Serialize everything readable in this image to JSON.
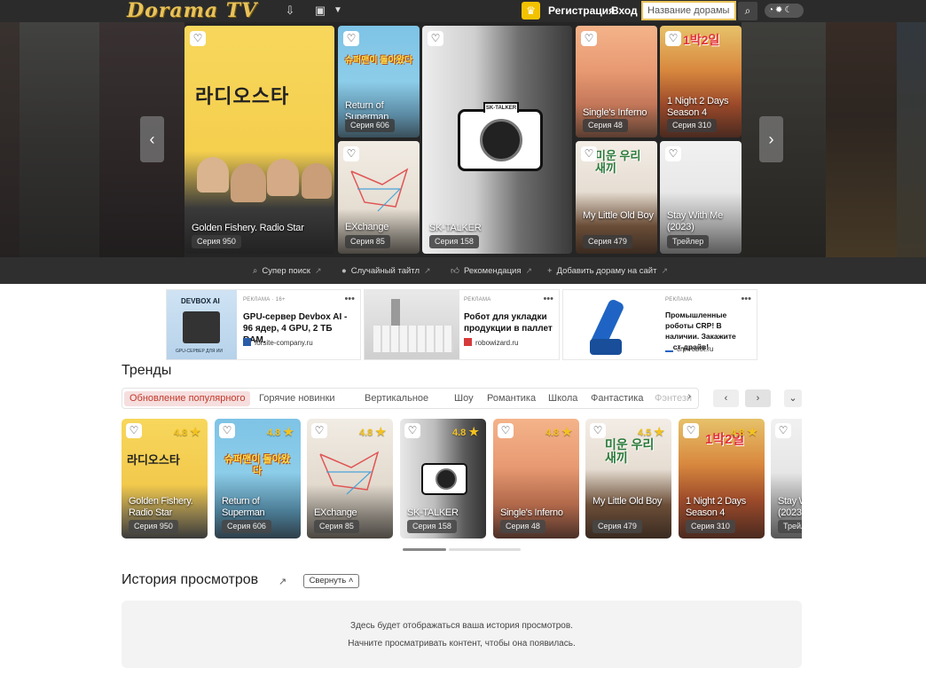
{
  "header": {
    "logo": "Dorama TV",
    "register_label": "Регистрация",
    "login_label": "Вход",
    "search_placeholder": "Название дорамы",
    "icons": [
      "download-icon",
      "tv-icon",
      "chevron-down-icon",
      "crown-icon",
      "search-icon",
      "theme-toggle-icon"
    ]
  },
  "hero": {
    "cards": [
      {
        "title": "Golden Fishery. Radio Star",
        "episode": "Серия 950"
      },
      {
        "title": "Return of Superman",
        "episode": "Серия 606"
      },
      {
        "title": "EXchange",
        "episode": "Серия 85"
      },
      {
        "title": "SK-TALKER",
        "episode": "Серия 158"
      },
      {
        "title": "Single's Inferno",
        "episode": "Серия 48"
      },
      {
        "title": "My Little Old Boy",
        "episode": "Серия 479"
      },
      {
        "title": "1 Night 2 Days Season 4",
        "episode": "Серия 310"
      },
      {
        "title": "Stay With Me (2023)",
        "episode": "Трейлер"
      }
    ],
    "poster_texts": {
      "radio_star": "라디오스타",
      "superman": "슈퍼맨이 돌아왔다",
      "sk_talker": "SK-TALKER",
      "mio": "미운 우리새끼",
      "one_night": "1박2일"
    }
  },
  "subnav": {
    "links": [
      "Супер поиск",
      "Случайный тайтл",
      "Рекомендация",
      "Добавить дораму на сайт"
    ]
  },
  "ads": [
    {
      "tag": "РЕКЛАМА · 16+",
      "image_label": "DEVBOX AI",
      "image_sub": "GPU-СЕРВЕР ДЛЯ ИИ",
      "headline": "GPU-сервер Devbox AI - 96 ядер, 4 GPU, 2 ТБ RAM.",
      "domain": "forsite-company.ru"
    },
    {
      "tag": "РЕКЛАМА",
      "headline": "Робот для укладки продукции в паллет",
      "domain": "robowizard.ru"
    },
    {
      "tag": "РЕКЛАМА",
      "headline": "Промышленные роботы CRP! В наличии. Закажите тест-драйв!",
      "domain": "crp-robot.ru"
    }
  ],
  "trends": {
    "title": "Тренды",
    "tabs": [
      "Обновление популярного",
      "Горячие новинки",
      "Вертикальное",
      "Шоу",
      "Романтика",
      "Школа",
      "Фантастика",
      "Фэнтези"
    ],
    "cards": [
      {
        "title": "Golden Fishery. Radio Star",
        "episode": "Серия 950",
        "rating": "4.8"
      },
      {
        "title": "Return of Superman",
        "episode": "Серия 606",
        "rating": "4.8"
      },
      {
        "title": "EXchange",
        "episode": "Серия 85",
        "rating": "4.8"
      },
      {
        "title": "SK-TALKER",
        "episode": "Серия 158",
        "rating": "4.8"
      },
      {
        "title": "Single's Inferno",
        "episode": "Серия 48",
        "rating": "4.8"
      },
      {
        "title": "My Little Old Boy",
        "episode": "Серия 479",
        "rating": "4.5"
      },
      {
        "title": "1 Night 2 Days Season 4",
        "episode": "Серия 310",
        "rating": "4.8"
      },
      {
        "title": "Stay With Me (2023)",
        "episode": "Трейлер",
        "rating": ""
      }
    ]
  },
  "history": {
    "title": "История просмотров",
    "collapse_label": "Свернуть",
    "empty_line1": "Здесь будет отображаться ваша история просмотров.",
    "empty_line2": "Начните просматривать контент, чтобы она появилась."
  },
  "colors": {
    "accent": "#e8c25a",
    "active_tab_bg": "#f6dede",
    "active_tab_text": "#c0392b",
    "rating": "#f4c21f"
  }
}
